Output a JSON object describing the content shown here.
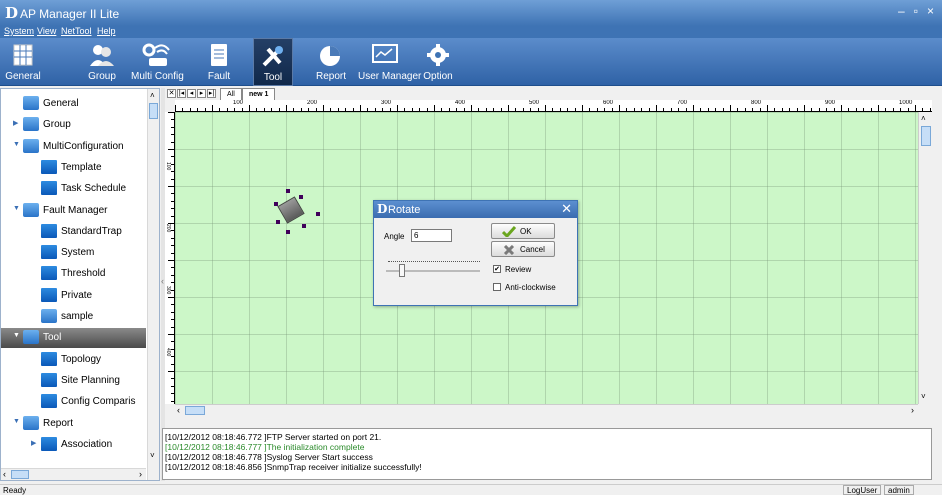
{
  "app": {
    "logo": "D",
    "title": "AP Manager II Lite",
    "window_controls": [
      "–",
      "▫",
      "×"
    ]
  },
  "menu": [
    "System",
    "View",
    "NetTool",
    "Help"
  ],
  "toolbar": [
    {
      "label": "General",
      "icon": "grid-icon"
    },
    {
      "label": "Group",
      "icon": "users-icon"
    },
    {
      "label": "Multi Config",
      "icon": "wireless-gear-icon"
    },
    {
      "label": "Fault",
      "icon": "clipboard-icon"
    },
    {
      "label": "Tool",
      "icon": "wrench-icon",
      "active": true
    },
    {
      "label": "Report",
      "icon": "pie-chart-icon"
    },
    {
      "label": "User Manager",
      "icon": "monitor-icon"
    },
    {
      "label": "Option",
      "icon": "gear-icon"
    }
  ],
  "tree": [
    {
      "label": "General",
      "icon": "grid-icon"
    },
    {
      "label": "Group",
      "icon": "users-icon",
      "expander": "▶"
    },
    {
      "label": "MultiConfiguration",
      "icon": "wireless-icon",
      "expander": "▼"
    },
    {
      "label": "Template",
      "icon": "folder-icon"
    },
    {
      "label": "Task Schedule",
      "icon": "folder-icon"
    },
    {
      "label": "Fault Manager",
      "icon": "clipboard-icon",
      "expander": "▼"
    },
    {
      "label": "StandardTrap",
      "icon": "folder-icon"
    },
    {
      "label": "System",
      "icon": "folder-icon"
    },
    {
      "label": "Threshold",
      "icon": "folder-icon"
    },
    {
      "label": "Private",
      "icon": "folder-icon"
    },
    {
      "label": "sample",
      "icon": "clipboard-icon"
    },
    {
      "label": "Tool",
      "icon": "wrench-icon",
      "expander": "▼",
      "selected": true
    },
    {
      "label": "Topology",
      "icon": "folder-icon"
    },
    {
      "label": "Site Planning",
      "icon": "folder-icon"
    },
    {
      "label": "Config Comparis",
      "icon": "folder-icon"
    },
    {
      "label": "Report",
      "icon": "pie-chart-icon",
      "expander": "▼"
    },
    {
      "label": "Association",
      "icon": "folder-icon",
      "expander": "▶"
    }
  ],
  "tabs": {
    "nav": [
      "✕",
      "|◂",
      "◂",
      "▸",
      "▸|"
    ],
    "items": [
      "All",
      "new 1"
    ]
  },
  "ruler": {
    "top": [
      "100",
      "200",
      "300",
      "400",
      "500",
      "600",
      "700",
      "800",
      "900",
      "1000",
      "1100"
    ],
    "left": [
      "100",
      "200",
      "300",
      "400",
      "500",
      "600",
      "700"
    ]
  },
  "dialog": {
    "logo": "D",
    "title": "Rotate",
    "close": "✕",
    "angle_label": "Angle",
    "angle_value": "6",
    "ok_label": "OK",
    "cancel_label": "Cancel",
    "review_label": "Review",
    "review_checked": true,
    "anticlockwise_label": "Anti-clockwise",
    "anticlockwise_checked": false
  },
  "log": [
    {
      "text": "[10/12/2012 08:18:46.772 ]FTP Server started on port 21.",
      "color": "#000000"
    },
    {
      "text": "[10/12/2012 08:18:46.777 ]The initialization complete",
      "color": "#2a8a2a"
    },
    {
      "text": "[10/12/2012 08:18:46.778 ]Syslog Server Start success",
      "color": "#000000"
    },
    {
      "text": "[10/12/2012 08:18:46.856 ]SnmpTrap receiver initialize successfully!",
      "color": "#000000"
    }
  ],
  "status": {
    "ready": "Ready",
    "log_user": "LogUser",
    "user": "admin"
  }
}
